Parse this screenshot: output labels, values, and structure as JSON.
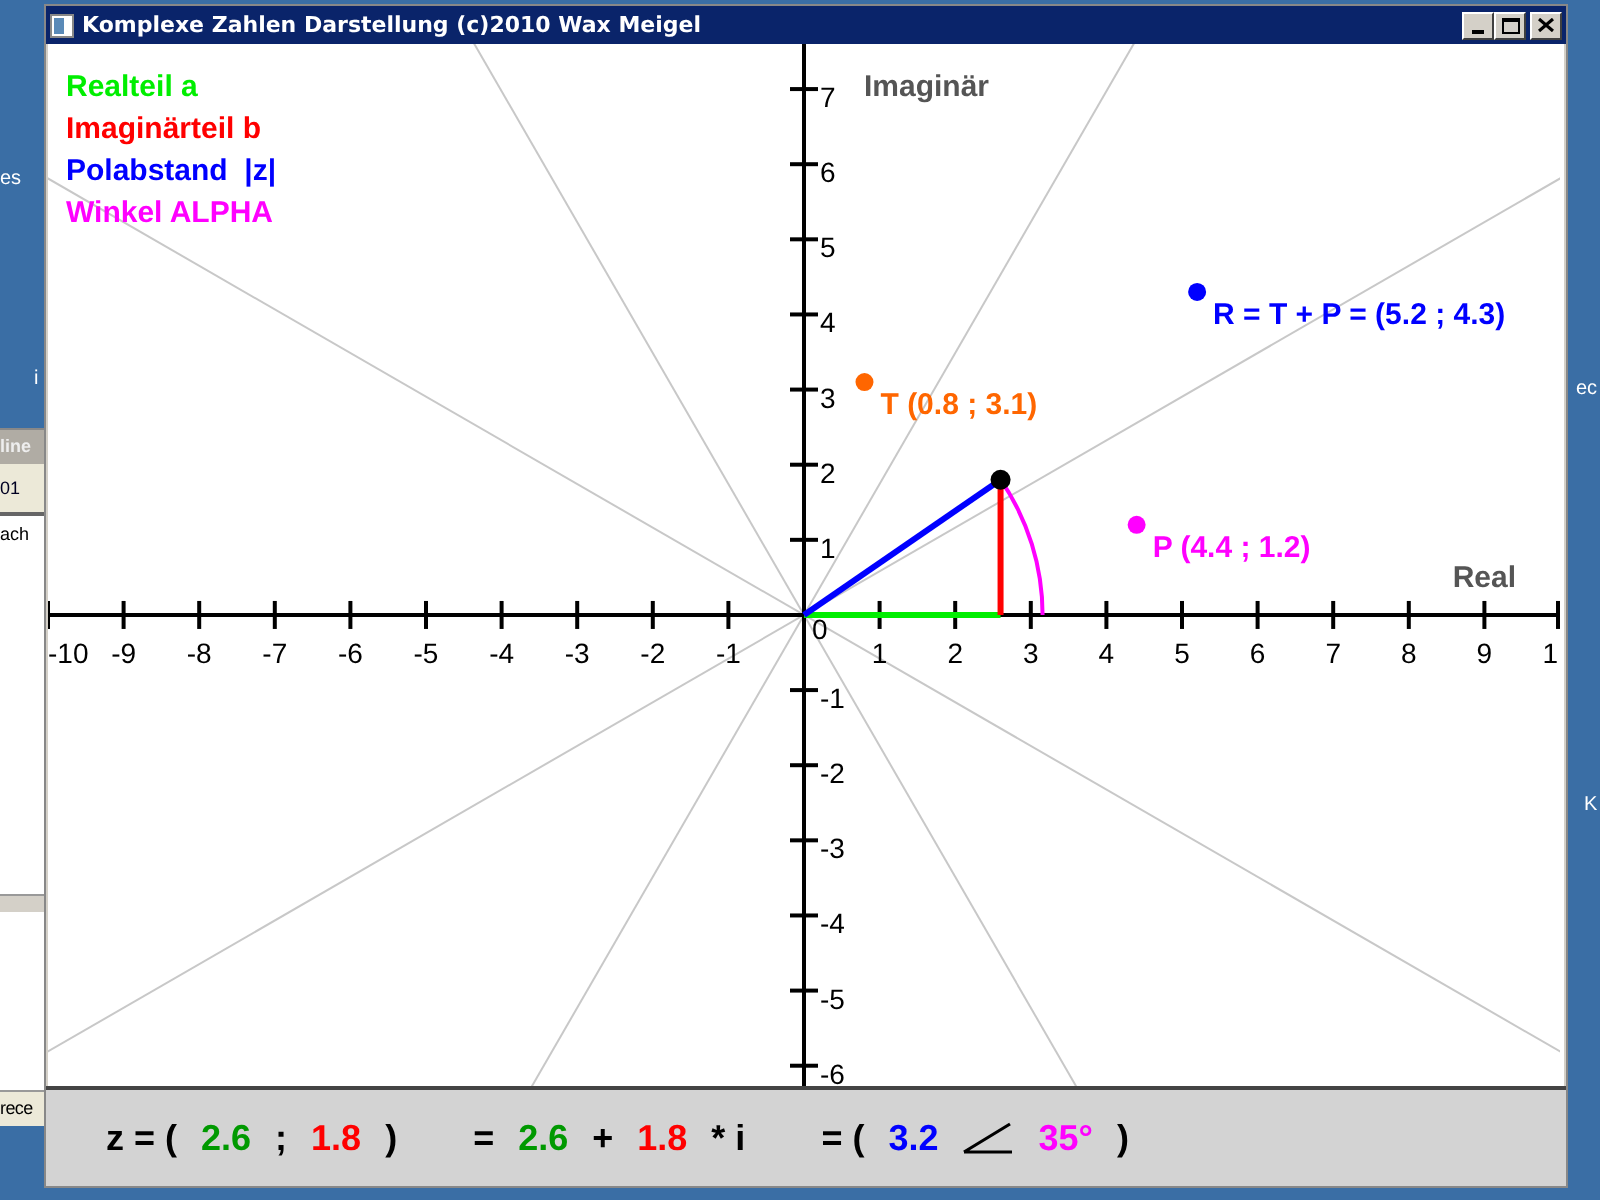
{
  "desktop": {
    "labels": [
      {
        "text": "es"
      },
      {
        "text": "i"
      },
      {
        "text": "ec"
      },
      {
        "text": "K"
      }
    ]
  },
  "background_window": {
    "header": "line",
    "row": "01",
    "body": "ach",
    "footer": "rece"
  },
  "window": {
    "title": "Komplexe Zahlen Darstellung (c)2010 Wax Meigel"
  },
  "legend": [
    {
      "text": "Realteil a",
      "color": "#00ee00"
    },
    {
      "text": "Imaginärteil b",
      "color": "#ff0000"
    },
    {
      "text": "Polabstand  |z|",
      "color": "#0000ff"
    },
    {
      "text": "Winkel ALPHA",
      "color": "#ff00ff"
    }
  ],
  "plane": {
    "origin_label": "0",
    "edge_label": "1",
    "chart_data": {
      "type": "scatter",
      "xlabel": "Real",
      "ylabel": "Imaginär",
      "xlim": [
        -10,
        10
      ],
      "ylim": [
        -6.27,
        7.6
      ],
      "xticks": [
        -10,
        -9,
        -8,
        -7,
        -6,
        -5,
        -4,
        -3,
        -2,
        -1,
        1,
        2,
        3,
        4,
        5,
        6,
        7,
        8,
        9
      ],
      "yticks": [
        -6,
        -5,
        -4,
        -3,
        -2,
        -1,
        1,
        2,
        3,
        4,
        5,
        6,
        7
      ],
      "series": [
        {
          "color": "#000000",
          "x": [
            2.6
          ],
          "values": [
            1.8
          ]
        },
        {
          "name": "T (0.8 ; 3.1)",
          "color": "#ff6600",
          "x": [
            0.8
          ],
          "values": [
            3.1
          ]
        },
        {
          "name": "P (4.4 ; 1.2)",
          "color": "#ff00ff",
          "x": [
            4.4
          ],
          "values": [
            1.2
          ]
        },
        {
          "name": "R = T + P = (5.2 ; 4.3)",
          "color": "#0000ff",
          "x": [
            5.2
          ],
          "values": [
            4.3
          ]
        }
      ]
    }
  },
  "formula": [
    {
      "segments": [
        {
          "kind": "text",
          "text": "z = (",
          "color": "#000000"
        },
        {
          "kind": "text",
          "text": "2.6",
          "color": "#009900"
        },
        {
          "kind": "text",
          "text": ";",
          "color": "#000000"
        },
        {
          "kind": "text",
          "text": "1.8",
          "color": "#ff0000"
        },
        {
          "kind": "text",
          "text": ")",
          "color": "#000000"
        }
      ]
    },
    {
      "segments": [
        {
          "kind": "text",
          "text": "=",
          "color": "#000000"
        },
        {
          "kind": "text",
          "text": "2.6",
          "color": "#009900"
        },
        {
          "kind": "text",
          "text": "+",
          "color": "#000000"
        },
        {
          "kind": "text",
          "text": "1.8",
          "color": "#ff0000"
        },
        {
          "kind": "text",
          "text": "* i",
          "color": "#000000"
        }
      ]
    },
    {
      "segments": [
        {
          "kind": "text",
          "text": "= (",
          "color": "#000000"
        },
        {
          "kind": "text",
          "text": "3.2",
          "color": "#0000ff"
        },
        {
          "kind": "angle",
          "color": "#000000"
        },
        {
          "kind": "text",
          "text": "35°",
          "color": "#ff00ff"
        },
        {
          "kind": "text",
          "text": ")",
          "color": "#000000"
        }
      ]
    }
  ]
}
